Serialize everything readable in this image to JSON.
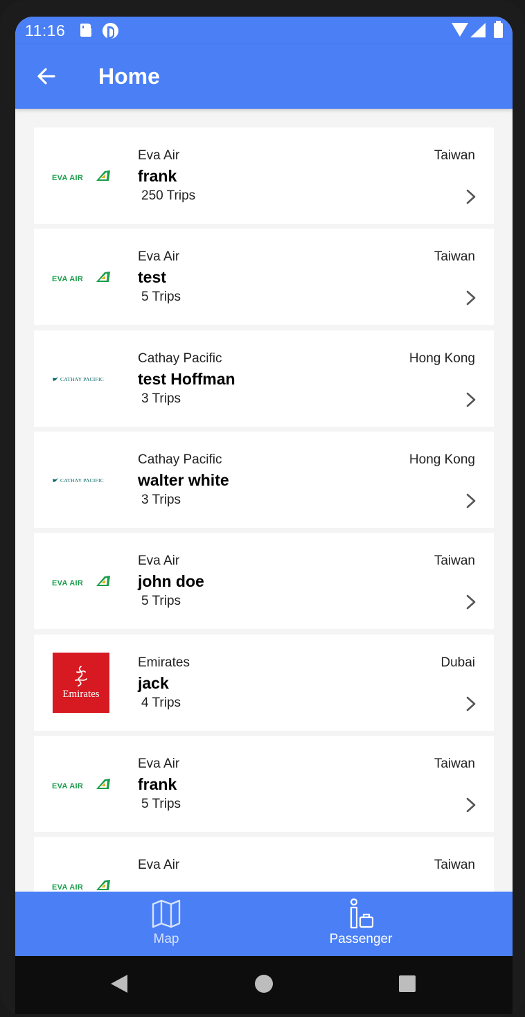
{
  "status_bar": {
    "time": "11:16",
    "icons": [
      "sd-card-icon",
      "app-notification-icon",
      "wifi-icon",
      "signal-icon",
      "battery-icon"
    ]
  },
  "app_bar": {
    "title": "Home",
    "back_icon": "arrow-left-icon"
  },
  "colors": {
    "primary": "#4a7ff5",
    "background": "#f4f4f4",
    "card": "#ffffff",
    "eva_green": "#1a9e4a",
    "cathay_teal": "#006564",
    "emirates_red": "#d71921"
  },
  "passengers": [
    {
      "airline": "Eva Air",
      "name": "frank",
      "trips": "250 Trips",
      "country": "Taiwan",
      "logo": "eva-air-logo",
      "logo_text": "EVA AIR"
    },
    {
      "airline": "Eva Air",
      "name": "test",
      "trips": "5 Trips",
      "country": "Taiwan",
      "logo": "eva-air-logo",
      "logo_text": "EVA AIR"
    },
    {
      "airline": "Cathay Pacific",
      "name": "test Hoffman",
      "trips": "3 Trips",
      "country": "Hong Kong",
      "logo": "cathay-pacific-logo",
      "logo_text": "CATHAY PACIFIC"
    },
    {
      "airline": "Cathay Pacific",
      "name": "walter white",
      "trips": "3 Trips",
      "country": "Hong Kong",
      "logo": "cathay-pacific-logo",
      "logo_text": "CATHAY PACIFIC"
    },
    {
      "airline": "Eva Air",
      "name": "john doe",
      "trips": "5 Trips",
      "country": "Taiwan",
      "logo": "eva-air-logo",
      "logo_text": "EVA AIR"
    },
    {
      "airline": "Emirates",
      "name": "jack",
      "trips": "4 Trips",
      "country": "Dubai",
      "logo": "emirates-logo",
      "logo_text": "Emirates"
    },
    {
      "airline": "Eva Air",
      "name": "frank",
      "trips": "5 Trips",
      "country": "Taiwan",
      "logo": "eva-air-logo",
      "logo_text": "EVA AIR"
    },
    {
      "airline": "Eva Air",
      "name": "",
      "trips": "",
      "country": "Taiwan",
      "logo": "eva-air-logo",
      "logo_text": "EVA AIR"
    }
  ],
  "bottom_nav": {
    "items": [
      {
        "label": "Map",
        "icon": "map-icon",
        "selected": false
      },
      {
        "label": "Passenger",
        "icon": "passenger-luggage-icon",
        "selected": true
      }
    ]
  },
  "system_nav": {
    "icons": [
      "system-back-icon",
      "system-home-icon",
      "system-recents-icon"
    ]
  }
}
